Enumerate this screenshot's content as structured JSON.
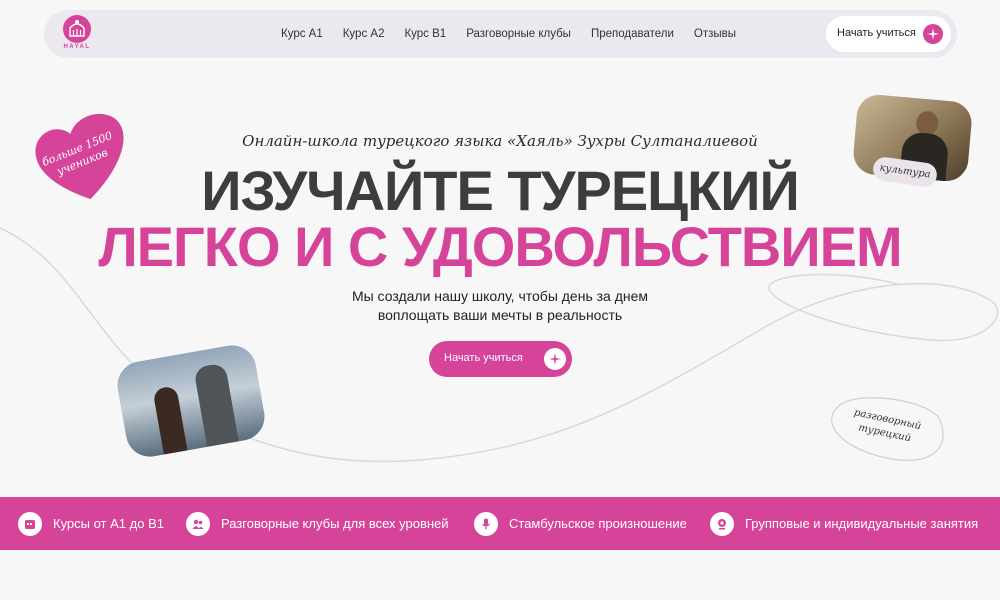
{
  "header": {
    "logo_text": "HAYAL",
    "nav": [
      "Курс А1",
      "Курс А2",
      "Курс В1",
      "Разговорные клубы",
      "Преподаватели",
      "Отзывы"
    ],
    "cta_label": "Начать учиться",
    "cta_icon": "sparkle-icon"
  },
  "hero": {
    "subtitle": "Онлайн-школа турецкого языка «Хаяль» Зухры Султаналиевой",
    "headline_line1": "ИЗУЧАЙТЕ ТУРЕЦКИЙ",
    "headline_line2": "ЛЕГКО И С УДОВОЛЬСТВИЕМ",
    "description_lines": [
      "Мы создали нашу школу, чтобы день за днем",
      "воплощать ваши мечты в реальность"
    ],
    "cta_label": "Начать учиться",
    "cta_icon": "sparkle-icon"
  },
  "badges": {
    "students": [
      "больше 1500",
      "учеников"
    ],
    "culture": "культура",
    "speaking": [
      "разговорный",
      "турецкий"
    ]
  },
  "features": [
    {
      "label": "Курсы от А1 до В1",
      "icon": "calendar-icon"
    },
    {
      "label": "Разговорные клубы для всех уровней",
      "icon": "people-icon"
    },
    {
      "label": "Стамбульское произношение",
      "icon": "microphone-icon"
    },
    {
      "label": "Групповые и индивидуальные занятия",
      "icon": "webcam-icon"
    }
  ],
  "colors": {
    "accent": "#d6449a",
    "text_dark": "#3d3d3d",
    "nav_bg": "#ebe8ef",
    "page_bg": "#f7f7f8"
  }
}
